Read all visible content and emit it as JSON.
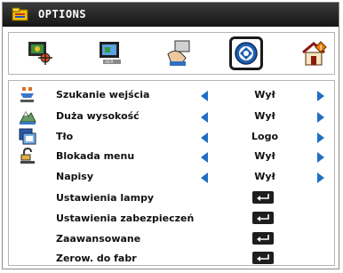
{
  "window": {
    "title": "OPTIONS",
    "title_icon": "menu-folder-icon"
  },
  "tabs": [
    {
      "name": "image-tab",
      "icon": "image-settings-icon",
      "active": false
    },
    {
      "name": "display-tab",
      "icon": "display-settings-icon",
      "active": false
    },
    {
      "name": "setup-tab",
      "icon": "setup-hand-icon",
      "active": false
    },
    {
      "name": "options-tab",
      "icon": "options-circle-icon",
      "active": true
    },
    {
      "name": "info-tab",
      "icon": "info-house-icon",
      "active": false
    }
  ],
  "menu": {
    "items": [
      {
        "label": "Szukanie wejścia",
        "icon": "source-search-icon",
        "value": "Wył",
        "control": "selector"
      },
      {
        "label": "Duża wysokość",
        "icon": "high-altitude-icon",
        "value": "Wył",
        "control": "selector"
      },
      {
        "label": "Tło",
        "icon": "background-icon",
        "value": "Logo",
        "control": "selector"
      },
      {
        "label": "Blokada menu",
        "icon": "menu-lock-icon",
        "value": "Wył",
        "control": "selector"
      },
      {
        "label": "Napisy",
        "icon": "",
        "value": "Wył",
        "control": "selector"
      },
      {
        "label": "Ustawienia lampy",
        "icon": "",
        "value": "",
        "control": "enter"
      },
      {
        "label": "Ustawienia zabezpieczeń",
        "icon": "",
        "value": "",
        "control": "enter"
      },
      {
        "label": "Zaawansowane",
        "icon": "",
        "value": "",
        "control": "enter"
      },
      {
        "label": "Zerow. do fabr",
        "icon": "",
        "value": "",
        "control": "enter"
      }
    ]
  },
  "colors": {
    "arrow": "#1f6fc4",
    "title_bar": "#1a1a1a",
    "enter_key": "#1e1e1e"
  }
}
